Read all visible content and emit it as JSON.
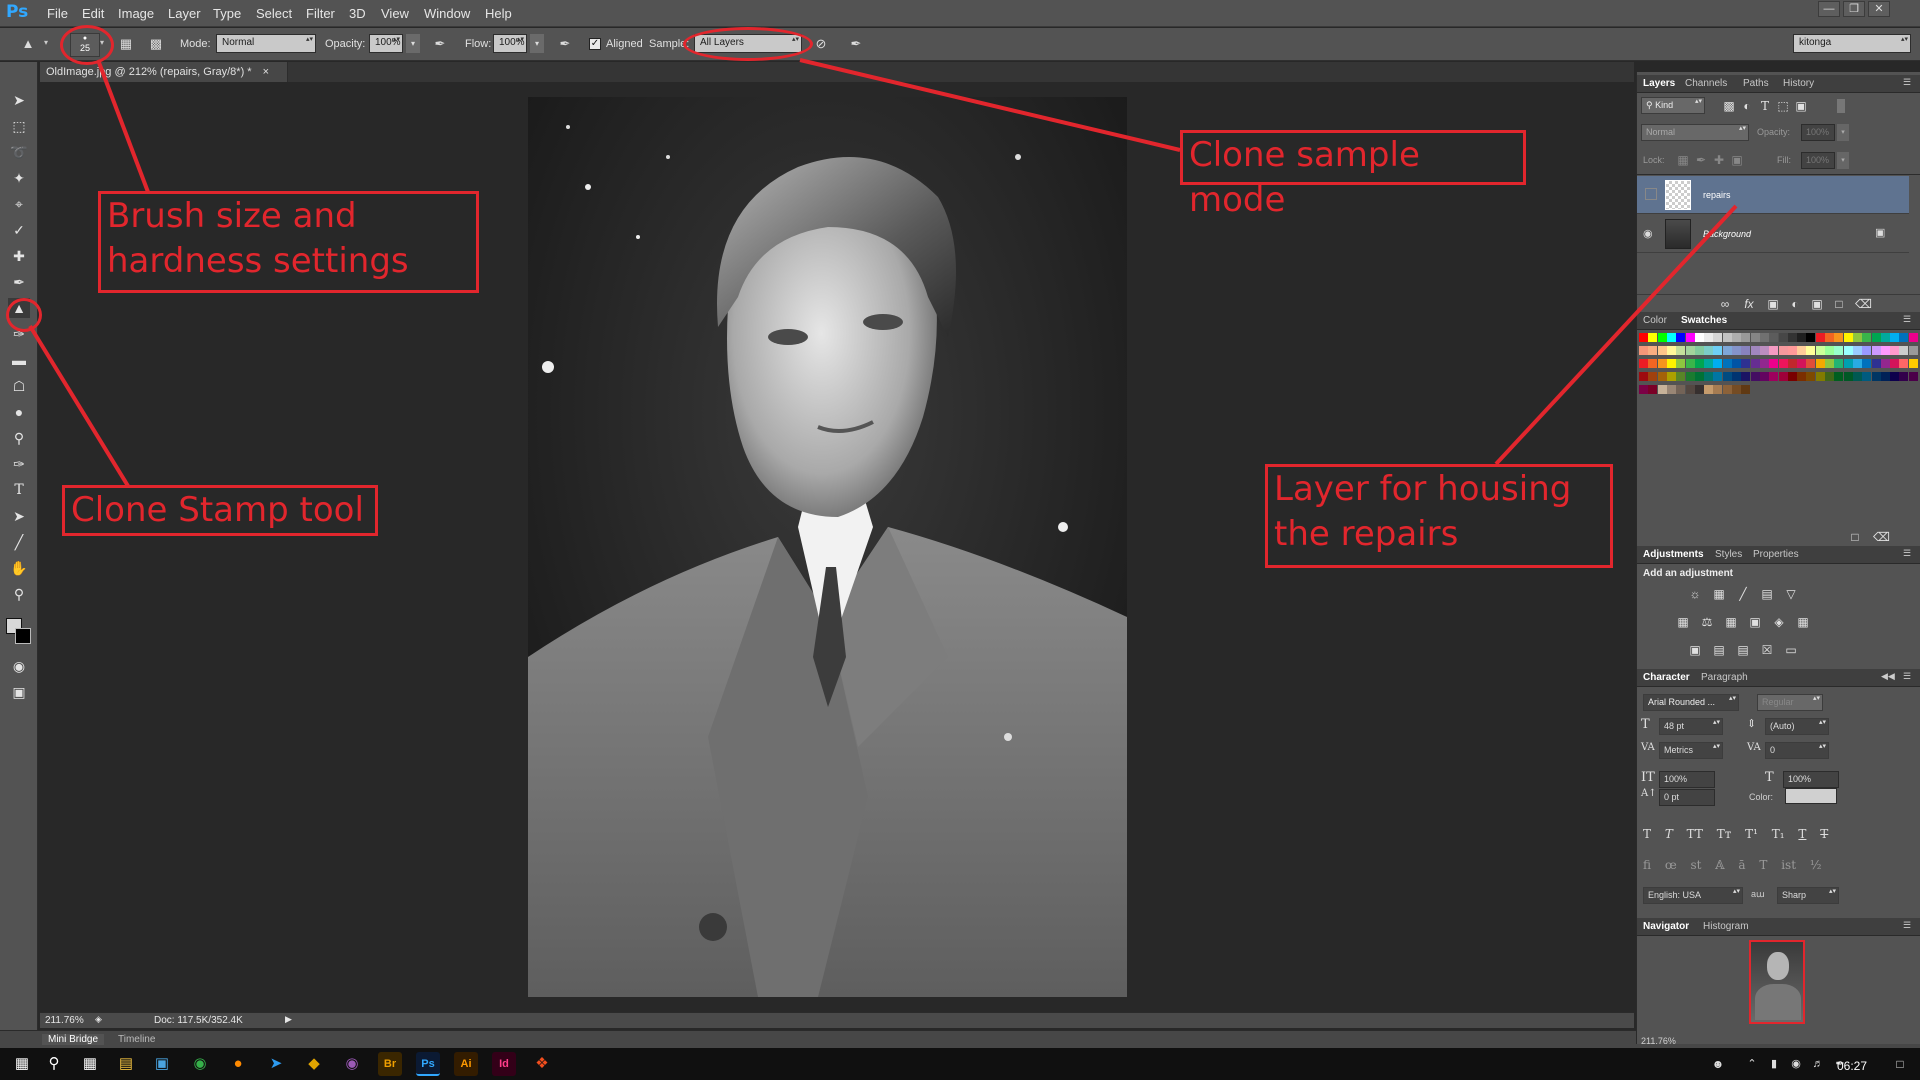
{
  "app": {
    "logo": "Ps"
  },
  "menu": [
    "File",
    "Edit",
    "Image",
    "Layer",
    "Type",
    "Select",
    "Filter",
    "3D",
    "View",
    "Window",
    "Help"
  ],
  "window_controls": {
    "minimize": "—",
    "restore": "❐",
    "close": "✕"
  },
  "options_bar": {
    "brush_size": "25",
    "mode_label": "Mode:",
    "mode_value": "Normal",
    "opacity_label": "Opacity:",
    "opacity_value": "100%",
    "flow_label": "Flow:",
    "flow_value": "100%",
    "aligned_label": "Aligned",
    "sample_label": "Sample:",
    "sample_value": "All Layers",
    "workspace_value": "kitonga"
  },
  "document": {
    "tab_title": "OldImage.jpg @ 212% (repairs, Gray/8*) *"
  },
  "status_bar": {
    "zoom": "211.76%",
    "doc_info": "Doc: 117.5K/352.4K"
  },
  "bottom_tabs": [
    "Mini Bridge",
    "Timeline"
  ],
  "layers_panel": {
    "tabs": [
      "Layers",
      "Channels",
      "Paths",
      "History"
    ],
    "filter_kind": "Kind",
    "blend_mode": "Normal",
    "opacity_label": "Opacity:",
    "opacity_value": "100%",
    "lock_label": "Lock:",
    "fill_label": "Fill:",
    "fill_value": "100%",
    "layers": [
      {
        "name": "repairs",
        "selected": true
      },
      {
        "name": "Background",
        "selected": false
      }
    ]
  },
  "swatches_panel": {
    "tabs": [
      "Color",
      "Swatches"
    ]
  },
  "adjustments_panel": {
    "tabs": [
      "Adjustments",
      "Styles",
      "Properties"
    ],
    "heading": "Add an adjustment"
  },
  "character_panel": {
    "tabs": [
      "Character",
      "Paragraph"
    ],
    "font_family": "Arial Rounded ...",
    "font_style": "Regular",
    "font_size": "48 pt",
    "leading": "(Auto)",
    "kerning": "Metrics",
    "tracking": "0",
    "vertical_scale": "100%",
    "horizontal_scale": "100%",
    "baseline_shift": "0 pt",
    "color_label": "Color:",
    "language": "English: USA",
    "aa_label": "aa",
    "antialias": "Sharp"
  },
  "navigator_panel": {
    "tabs": [
      "Navigator",
      "Histogram"
    ],
    "zoom": "211.76%"
  },
  "taskbar": {
    "time": "06:27"
  },
  "annotations": {
    "brush": "Brush size and hardness settings",
    "clone_stamp": "Clone Stamp tool",
    "sample_mode": "Clone sample mode",
    "layer": "Layer for housing the repairs"
  },
  "colors": {
    "annotation": "#e2262d",
    "selected_layer": "#5f7390",
    "ui_bg": "#535353"
  }
}
